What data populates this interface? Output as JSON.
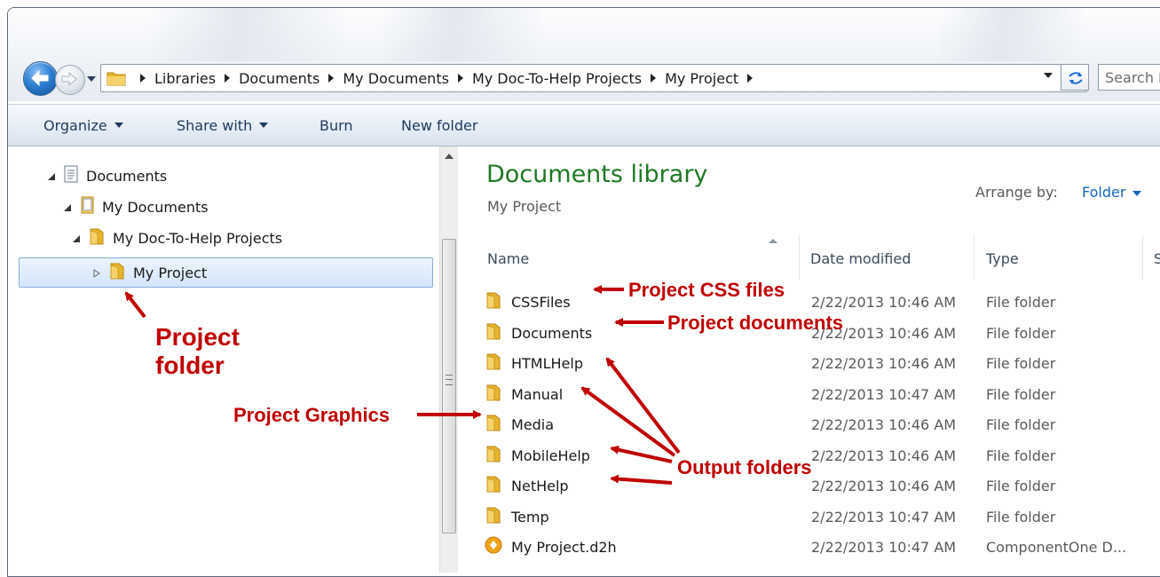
{
  "address": {
    "crumbs": [
      "Libraries",
      "Documents",
      "My Documents",
      "My Doc-To-Help Projects",
      "My Project"
    ],
    "search_placeholder": "Search My Project"
  },
  "toolbar": {
    "organize": "Organize",
    "share_with": "Share with",
    "burn": "Burn",
    "new_folder": "New folder"
  },
  "nav_tree": [
    {
      "label": "Documents"
    },
    {
      "label": "My Documents"
    },
    {
      "label": "My Doc-To-Help Projects"
    },
    {
      "label": "My Project"
    }
  ],
  "library": {
    "title": "Documents library",
    "subtitle": "My Project",
    "arrange_label": "Arrange by:",
    "arrange_value": "Folder"
  },
  "columns": {
    "name": "Name",
    "date": "Date modified",
    "type": "Type",
    "size": "S"
  },
  "files": [
    {
      "name": "CSSFiles",
      "date": "2/22/2013 10:46 AM",
      "type": "File folder"
    },
    {
      "name": "Documents",
      "date": "2/22/2013 10:46 AM",
      "type": "File folder"
    },
    {
      "name": "HTMLHelp",
      "date": "2/22/2013 10:46 AM",
      "type": "File folder"
    },
    {
      "name": "Manual",
      "date": "2/22/2013 10:47 AM",
      "type": "File folder"
    },
    {
      "name": "Media",
      "date": "2/22/2013 10:46 AM",
      "type": "File folder"
    },
    {
      "name": "MobileHelp",
      "date": "2/22/2013 10:46 AM",
      "type": "File folder"
    },
    {
      "name": "NetHelp",
      "date": "2/22/2013 10:46 AM",
      "type": "File folder"
    },
    {
      "name": "Temp",
      "date": "2/22/2013 10:47 AM",
      "type": "File folder"
    },
    {
      "name": "My Project.d2h",
      "date": "2/22/2013 10:47 AM",
      "type": "ComponentOne D..."
    }
  ],
  "annotations": {
    "project_folder_1": "Project",
    "project_folder_2": "folder",
    "project_graphics": "Project Graphics",
    "project_css": "Project CSS files",
    "project_documents": "Project documents",
    "output_folders": "Output folders"
  },
  "colors": {
    "annotation": "#c00000",
    "library_title": "#1e7a23",
    "link": "#1565c0",
    "folder": "#e8b52a",
    "selection": "#d3e5fb"
  }
}
